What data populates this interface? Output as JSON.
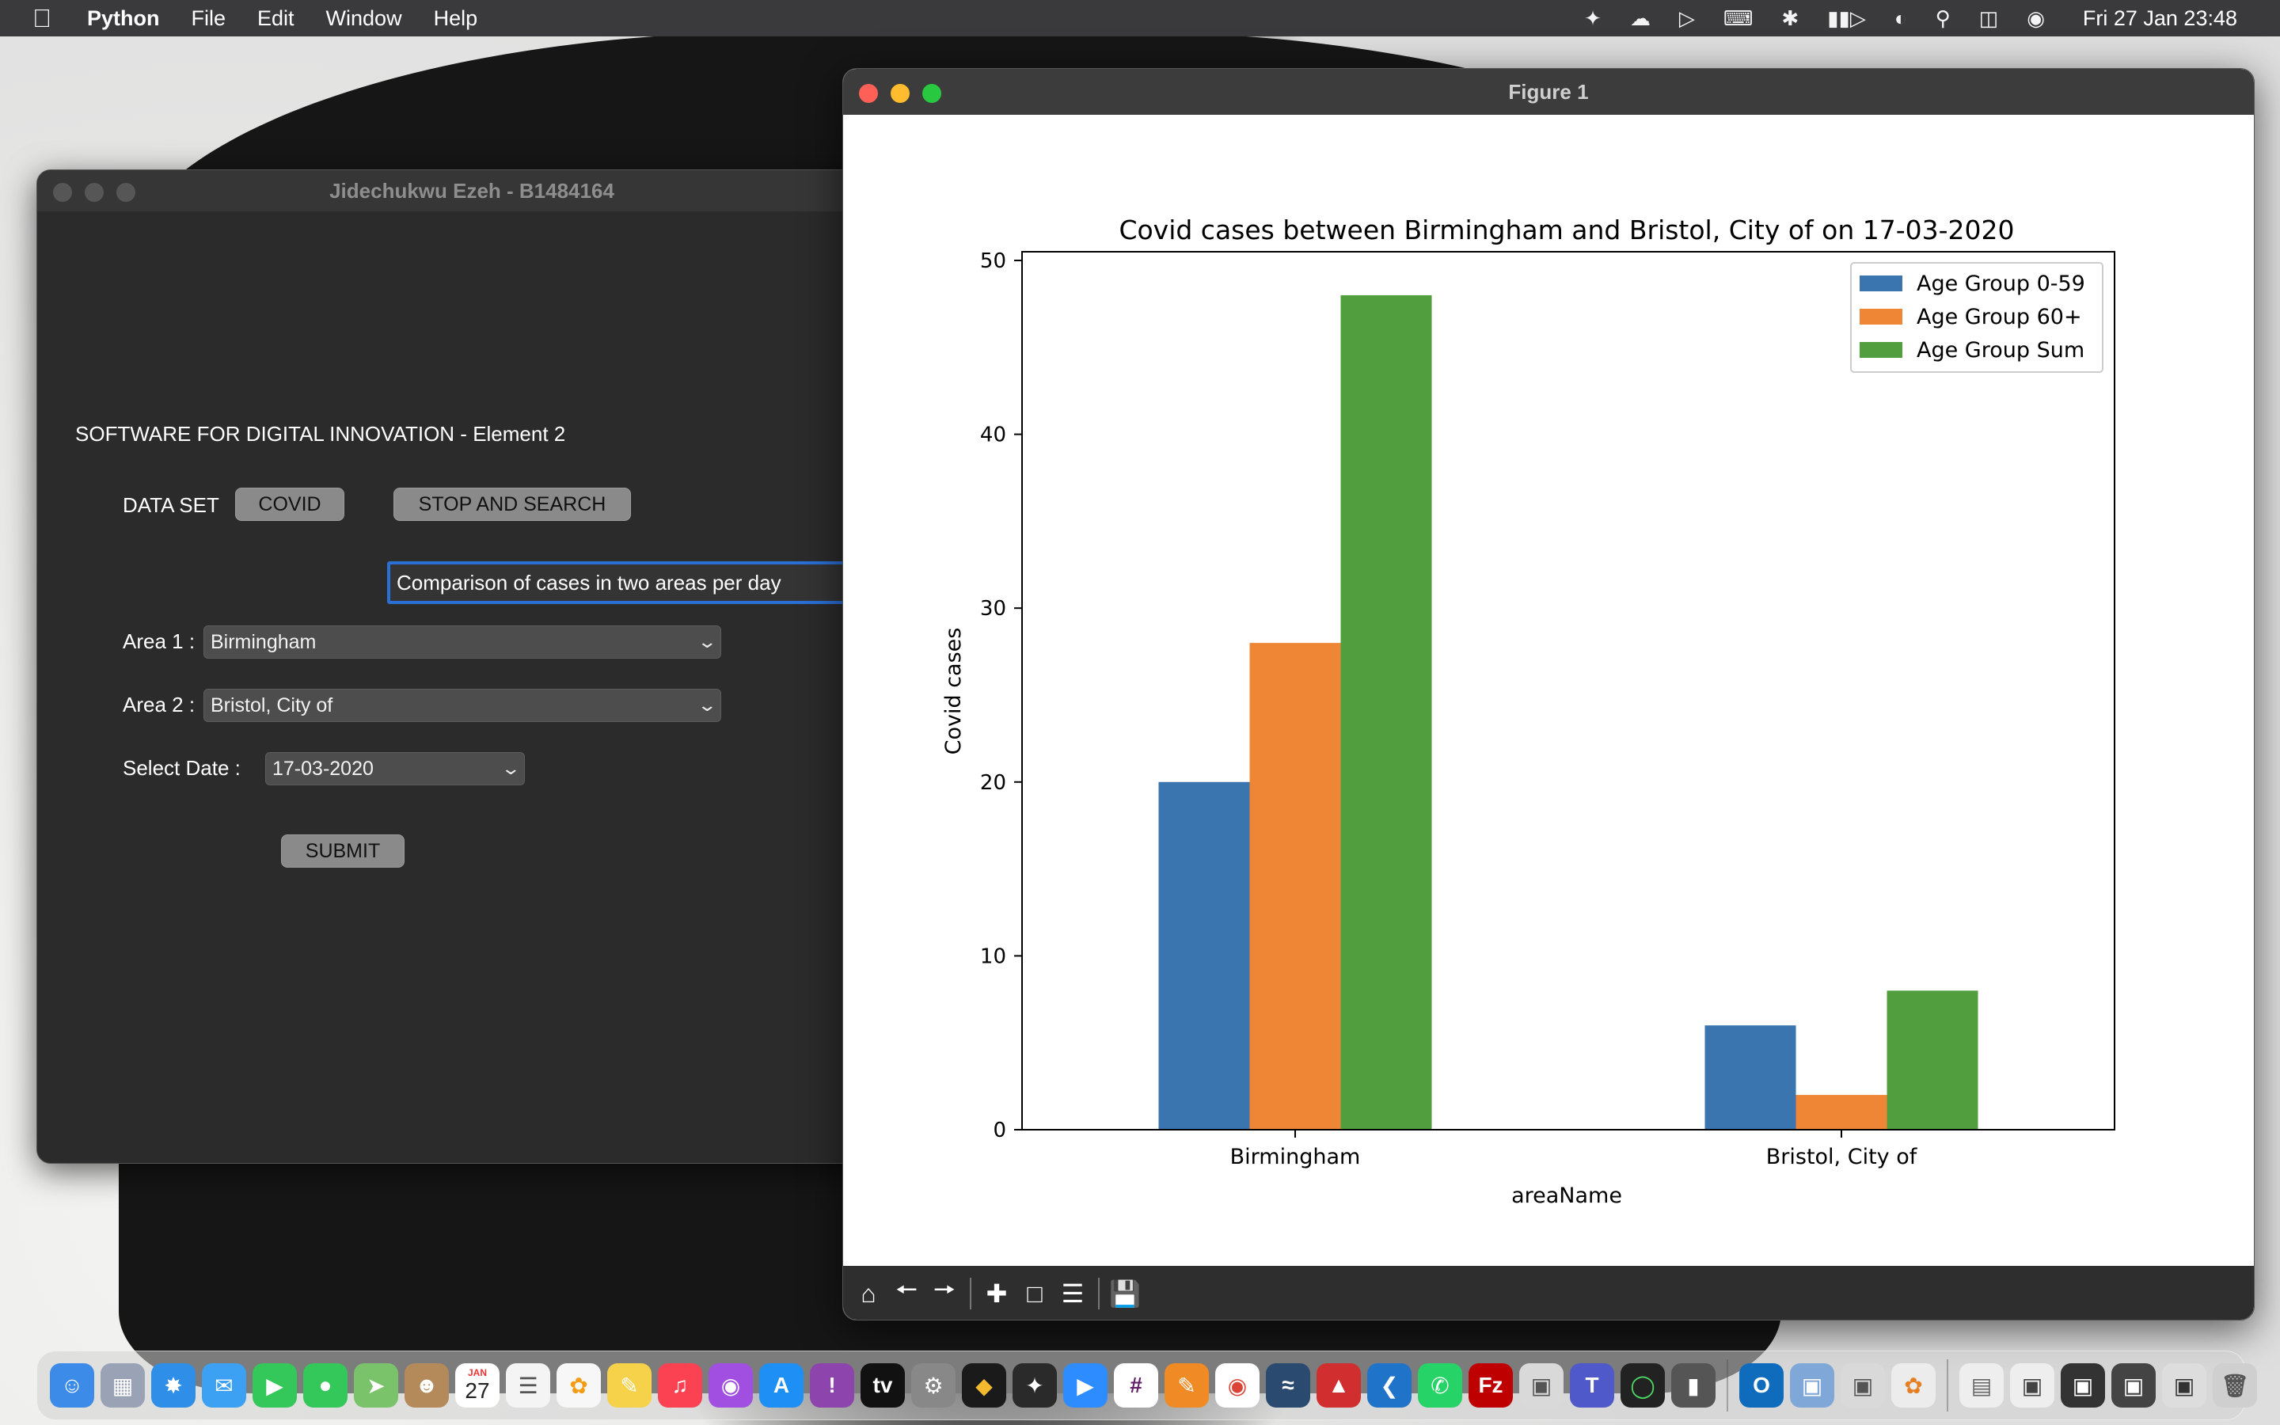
{
  "menubar": {
    "app_name": "Python",
    "menus": [
      "File",
      "Edit",
      "Window",
      "Help"
    ],
    "clock": "Fri 27 Jan  23:48"
  },
  "tk_window": {
    "title": "Jidechukwu Ezeh - B1484164",
    "heading": "SOFTWARE FOR DIGITAL INNOVATION - Element 2",
    "dataset_label": "DATA SET",
    "covid_button": "COVID",
    "stop_search_button": "STOP AND SEARCH",
    "comparison_field": "Comparison of cases in two areas per day",
    "area1_label": "Area 1 :",
    "area1_value": "Birmingham",
    "area2_label": "Area 2 :",
    "area2_value": "Bristol, City of",
    "date_label": "Select Date :",
    "date_value": "17-03-2020",
    "submit_button": "SUBMIT"
  },
  "figure_window": {
    "title": "Figure 1"
  },
  "chart_data": {
    "type": "bar",
    "title": "Covid cases between Birmingham and Bristol, City of on 17-03-2020",
    "xlabel": "areaName",
    "ylabel": "Covid cases",
    "categories": [
      "Birmingham",
      "Bristol, City of"
    ],
    "series": [
      {
        "name": "Age Group 0-59",
        "values": [
          20,
          6
        ],
        "color": "#3a75b0"
      },
      {
        "name": "Age Group 60+",
        "values": [
          28,
          2
        ],
        "color": "#ef8636"
      },
      {
        "name": "Age Group Sum",
        "values": [
          48,
          8
        ],
        "color": "#519e3e"
      }
    ],
    "ylim": [
      0,
      50.5
    ],
    "yticks": [
      0,
      10,
      20,
      30,
      40,
      50
    ],
    "legend": "top-right",
    "grid": false
  },
  "toolbar_icons": [
    "home-icon",
    "back-arrow-icon",
    "forward-arrow-icon",
    "pan-icon",
    "zoom-icon",
    "configure-subplots-icon",
    "save-icon"
  ],
  "dock": {
    "calendar_month": "JAN",
    "calendar_day": "27",
    "apps": [
      "finder",
      "launchpad",
      "safari",
      "mail",
      "facetime",
      "messages",
      "maps",
      "contacts",
      "calendar",
      "reminders",
      "photos",
      "notes",
      "music",
      "podcasts",
      "app-store",
      "feedback",
      "tv",
      "system-preferences",
      "binance",
      "figma",
      "zoom",
      "slack",
      "sketch",
      "chrome",
      "mysql-workbench",
      "acrobat",
      "vscode",
      "whatsapp",
      "filezilla",
      "preview",
      "teams",
      "activity",
      "parallels",
      "outlook",
      "screen-sharing",
      "preview-2",
      "creative",
      "folder-1",
      "folder-2",
      "folder-3",
      "folder-4",
      "folder-5",
      "trash"
    ]
  }
}
